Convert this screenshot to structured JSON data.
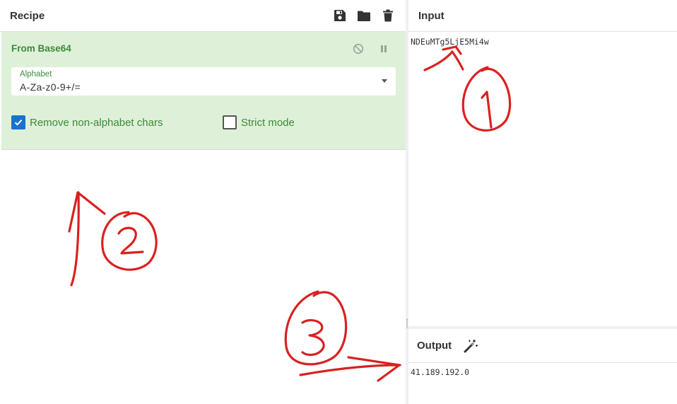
{
  "recipe": {
    "title": "Recipe",
    "actions": [
      "save-icon",
      "folder-icon",
      "trash-icon"
    ],
    "operation": {
      "name": "From Base64",
      "controls": [
        "disable-icon",
        "pause-icon"
      ],
      "alphabet": {
        "label": "Alphabet",
        "value": "A-Za-z0-9+/="
      },
      "remove_non_alphabet": {
        "label": "Remove non-alphabet chars",
        "checked": true
      },
      "strict_mode": {
        "label": "Strict mode",
        "checked": false
      }
    }
  },
  "input": {
    "title": "Input",
    "text": "NDEuMTg5LjE5Mi4w"
  },
  "output": {
    "title": "Output",
    "magic_icon": "magic-wand-icon",
    "text": "41.189.192.0"
  },
  "colors": {
    "operation_bg": "#dff0d8",
    "operation_text": "#3c8a3a",
    "checkbox_accent": "#1a73c8",
    "annotation": "#d92121"
  }
}
